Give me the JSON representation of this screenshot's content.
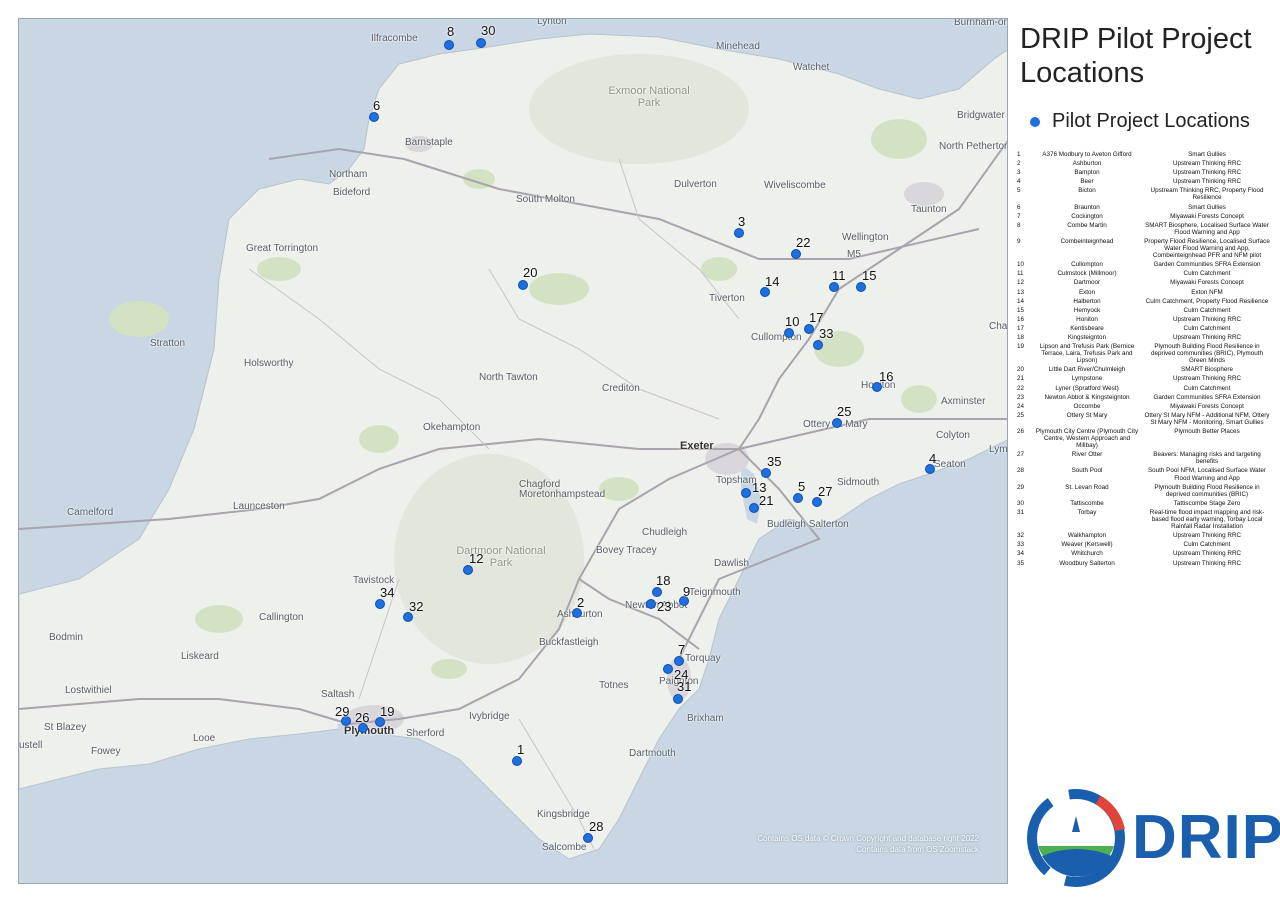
{
  "title": "DRIP Pilot Project Locations",
  "legend": {
    "label": "Pilot Project Locations",
    "color": "#1f6fde"
  },
  "brand": {
    "name": "DRIP",
    "color": "#1a5fae",
    "accent_green": "#4caf50",
    "accent_red": "#e0443a"
  },
  "attribution": {
    "line1": "Contains OS data © Crown Copyright and database right 2022",
    "line2": "Contains data from OS Zoomstack"
  },
  "places": [
    {
      "name": "Lynton"
    },
    {
      "name": "Burnham-on"
    },
    {
      "name": "Ilfracombe"
    },
    {
      "name": "Minehead"
    },
    {
      "name": "Watchet"
    },
    {
      "name": "Exmoor National Park",
      "park": true
    },
    {
      "name": "Bridgwater"
    },
    {
      "name": "North Petherton"
    },
    {
      "name": "Barnstaple"
    },
    {
      "name": "Northam"
    },
    {
      "name": "Bideford"
    },
    {
      "name": "Dulverton"
    },
    {
      "name": "Wiveliscombe"
    },
    {
      "name": "South Molton"
    },
    {
      "name": "Taunton"
    },
    {
      "name": "Wellington"
    },
    {
      "name": "Great Torrington"
    },
    {
      "name": "M5"
    },
    {
      "name": "Tiverton"
    },
    {
      "name": "Cullompton"
    },
    {
      "name": "Char"
    },
    {
      "name": "Stratton"
    },
    {
      "name": "Holsworthy"
    },
    {
      "name": "North Tawton"
    },
    {
      "name": "Crediton"
    },
    {
      "name": "Honiton"
    },
    {
      "name": "Axminster"
    },
    {
      "name": "Okehampton"
    },
    {
      "name": "Ottery St Mary"
    },
    {
      "name": "Colyton"
    },
    {
      "name": "Exeter",
      "major": true
    },
    {
      "name": "Lym"
    },
    {
      "name": "Topsham"
    },
    {
      "name": "Sidmouth"
    },
    {
      "name": "Seaton"
    },
    {
      "name": "Chagford"
    },
    {
      "name": "Moretonhampstead"
    },
    {
      "name": "Camelford"
    },
    {
      "name": "Launceston"
    },
    {
      "name": "Budleigh Salterton"
    },
    {
      "name": "Chudleigh"
    },
    {
      "name": "Dartmoor National Park",
      "park": true
    },
    {
      "name": "Bovey Tracey"
    },
    {
      "name": "Dawlish"
    },
    {
      "name": "Tavistock"
    },
    {
      "name": "Callington"
    },
    {
      "name": "Newton Abbot"
    },
    {
      "name": "Teignmouth"
    },
    {
      "name": "Ashburton"
    },
    {
      "name": "Bodmin"
    },
    {
      "name": "Buckfastleigh"
    },
    {
      "name": "Liskeard"
    },
    {
      "name": "Torquay"
    },
    {
      "name": "Lostwithiel"
    },
    {
      "name": "Totnes"
    },
    {
      "name": "Paignton"
    },
    {
      "name": "Saltash"
    },
    {
      "name": "Brixham"
    },
    {
      "name": "St Blazey"
    },
    {
      "name": "Looe"
    },
    {
      "name": "Ivybridge"
    },
    {
      "name": "Plymouth",
      "major": true
    },
    {
      "name": "Sherford"
    },
    {
      "name": "Fowey"
    },
    {
      "name": "ustell"
    },
    {
      "name": "Dartmouth"
    },
    {
      "name": "Kingsbridge"
    },
    {
      "name": "Salcombe"
    }
  ],
  "markers": [
    "8",
    "30",
    "6",
    "3",
    "22",
    "20",
    "14",
    "11",
    "15",
    "10",
    "17",
    "33",
    "16",
    "25",
    "35",
    "13",
    "21",
    "5",
    "27",
    "4",
    "12",
    "18",
    "23",
    "9",
    "2",
    "34",
    "32",
    "7",
    "24",
    "31",
    "29",
    "26",
    "19",
    "1",
    "28"
  ],
  "projects": [
    {
      "num": "1",
      "location": "A376 Modbury to Aveton Gifford",
      "project": "Smart Gullies"
    },
    {
      "num": "2",
      "location": "Ashburton",
      "project": "Upstream Thinking RRC"
    },
    {
      "num": "3",
      "location": "Bampton",
      "project": "Upstream Thinking RRC"
    },
    {
      "num": "4",
      "location": "Beer",
      "project": "Upstream Thinking RRC"
    },
    {
      "num": "5",
      "location": "Bicton",
      "project": "Upstream Thinking RRC, Property Flood Resilience"
    },
    {
      "num": "6",
      "location": "Braunton",
      "project": "Smart Gullies"
    },
    {
      "num": "7",
      "location": "Cockington",
      "project": "Miyawaki Forests Concept"
    },
    {
      "num": "8",
      "location": "Combe Martin",
      "project": "SMART Biosphere, Localised Surface Water Flood Warning and App"
    },
    {
      "num": "9",
      "location": "Combeinteignhead",
      "project": "Property Flood Resilience, Localised Surface Water Flood Warning and App, Combeinteignhead PFR and NFM pilot"
    },
    {
      "num": "10",
      "location": "Cullompton",
      "project": "Garden Communities SFRA Extension"
    },
    {
      "num": "11",
      "location": "Culmstock (Millmoor)",
      "project": "Culm Catchment"
    },
    {
      "num": "12",
      "location": "Dartmoor",
      "project": "Miyawaki Forests Concept"
    },
    {
      "num": "13",
      "location": "Exton",
      "project": "Exton NFM"
    },
    {
      "num": "14",
      "location": "Halberton",
      "project": "Culm Catchment, Property Flood Resilience"
    },
    {
      "num": "15",
      "location": "Hemyock",
      "project": "Culm Catchment"
    },
    {
      "num": "16",
      "location": "Honiton",
      "project": "Upstream Thinking RRC"
    },
    {
      "num": "17",
      "location": "Kentisbeare",
      "project": "Culm Catchment"
    },
    {
      "num": "18",
      "location": "Kingsteignton",
      "project": "Upstream Thinking RRC"
    },
    {
      "num": "19",
      "location": "Lipson and Trefusis Park (Bernice Terrace, Laira, Trefusis Park and Lipson)",
      "project": "Plymouth Building Flood Resilience in deprived communities (BRIC), Plymouth Green Minds"
    },
    {
      "num": "20",
      "location": "Little Dart River/Chulmleigh",
      "project": "SMART Biosphere"
    },
    {
      "num": "21",
      "location": "Lympstone",
      "project": "Upstream Thinking RRC"
    },
    {
      "num": "22",
      "location": "Lyner (Spratford West)",
      "project": "Culm Catchment"
    },
    {
      "num": "23",
      "location": "Newton Abbot & Kingsteignton",
      "project": "Garden Communities SFRA Extension"
    },
    {
      "num": "24",
      "location": "Occombe",
      "project": "Miyawaki Forests Concept"
    },
    {
      "num": "25",
      "location": "Ottery St Mary",
      "project": "Ottery St Mary NFM - Additional NFM, Ottery St Mary NFM - Monitoring, Smart Gullies"
    },
    {
      "num": "26",
      "location": "Plymouth City Centre (Plymouth City Centre, Western Approach and Millbay)",
      "project": "Plymouth Better Places"
    },
    {
      "num": "27",
      "location": "River Otter",
      "project": "Beavers: Managing risks and targeting benefits"
    },
    {
      "num": "28",
      "location": "South Pool",
      "project": "South Pool NFM, Localised Surface Water Flood Warning and App"
    },
    {
      "num": "29",
      "location": "St. Levan Road",
      "project": "Plymouth Building Flood Resilience in deprived communities (BRIC)"
    },
    {
      "num": "30",
      "location": "Tattiscombe",
      "project": "Tattiscombe Stage Zero"
    },
    {
      "num": "31",
      "location": "Torbay",
      "project": "Real-time flood impact mapping and risk-based flood early warning, Torbay Local Rainfall Radar Installation"
    },
    {
      "num": "32",
      "location": "Walkhampton",
      "project": "Upstream Thinking RRC"
    },
    {
      "num": "33",
      "location": "Weaver (Kerswell)",
      "project": "Culm Catchment"
    },
    {
      "num": "34",
      "location": "Whitchurch",
      "project": "Upstream Thinking RRC"
    },
    {
      "num": "35",
      "location": "Woodbury Salterton",
      "project": "Upstream Thinking RRC"
    }
  ]
}
